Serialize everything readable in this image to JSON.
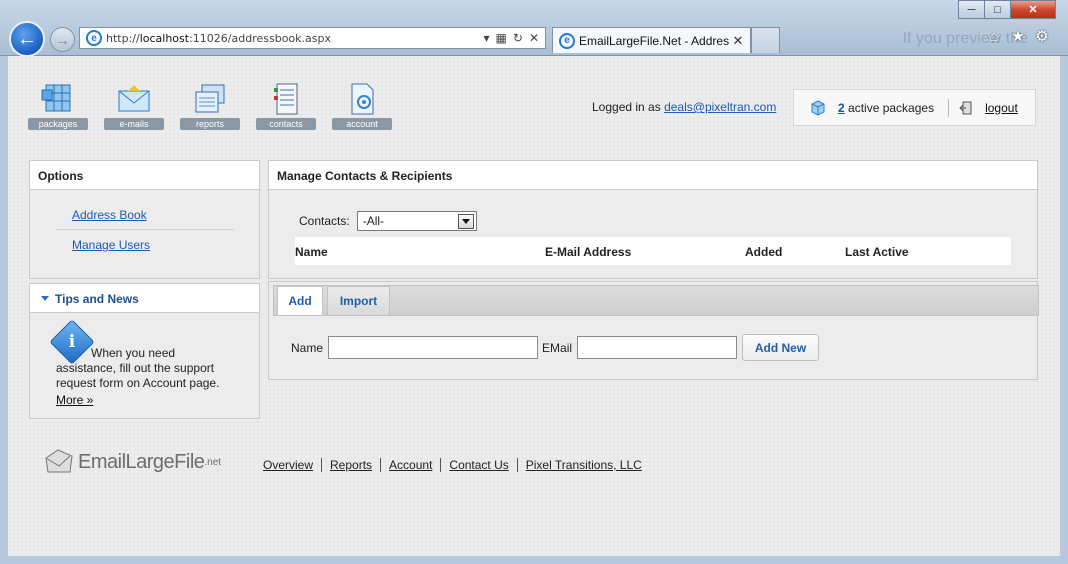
{
  "browser": {
    "url_prefix": "http://",
    "url_host": "localhost",
    "url_rest": ":11026/addressbook.aspx",
    "tab_title": "EmailLargeFile.Net - Addres...",
    "background_text": "If you preview the"
  },
  "nav": {
    "items": [
      {
        "label": "packages"
      },
      {
        "label": "e-mails"
      },
      {
        "label": "reports"
      },
      {
        "label": "contacts"
      },
      {
        "label": "account"
      }
    ]
  },
  "header": {
    "logged_in_prefix": "Logged in as",
    "user_email": "deals@pixeltran.com",
    "package_count": "2",
    "package_suffix": "active packages",
    "logout_label": "logout"
  },
  "options": {
    "title": "Options",
    "links": [
      "Address Book",
      "Manage Users"
    ]
  },
  "tips": {
    "title": "Tips and News",
    "text": "When you need assistance, fill out the support request form on Account page.",
    "more_label": "More »"
  },
  "manage": {
    "title": "Manage Contacts & Recipients",
    "contacts_label": "Contacts:",
    "contacts_selected": "-All-",
    "columns": [
      "Name",
      "E-Mail Address",
      "Added",
      "Last Active"
    ]
  },
  "add_panel": {
    "tabs": [
      "Add",
      "Import"
    ],
    "name_label": "Name",
    "email_label": "EMail",
    "add_button": "Add New"
  },
  "footer": {
    "logo_text": "EmailLargeFile",
    "logo_suffix": ".net",
    "links": [
      "Overview",
      "Reports",
      "Account",
      "Contact Us",
      "Pixel Transitions, LLC"
    ]
  }
}
